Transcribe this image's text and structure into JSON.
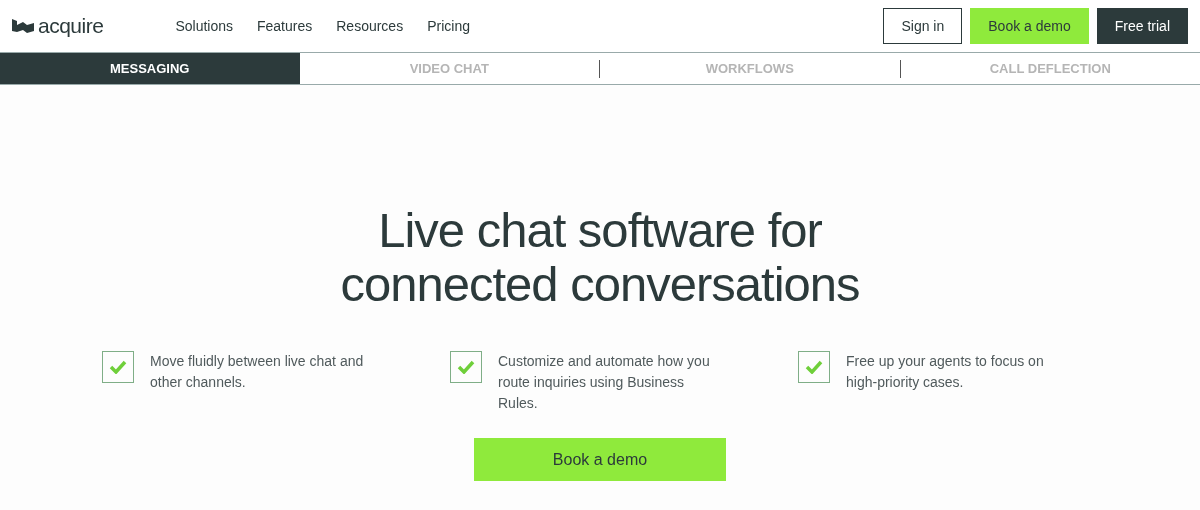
{
  "brand": {
    "name": "acquire"
  },
  "nav": {
    "links": [
      "Solutions",
      "Features",
      "Resources",
      "Pricing"
    ],
    "buttons": [
      {
        "label": "Sign in",
        "kind": "outline"
      },
      {
        "label": "Book a demo",
        "kind": "accent"
      },
      {
        "label": "Free trial",
        "kind": "dark"
      }
    ]
  },
  "tabs": [
    {
      "label": "MESSAGING",
      "selected": true
    },
    {
      "label": "VIDEO CHAT",
      "selected": false
    },
    {
      "label": "WORKFLOWS",
      "selected": false
    },
    {
      "label": "CALL DEFLECTION",
      "selected": false
    }
  ],
  "hero": {
    "title_lines": [
      "Live chat software for",
      "connected conversations"
    ],
    "features": [
      {
        "text": "Move fluidly between live chat and other channels.",
        "checked": true
      },
      {
        "text": "Customize and automate how you route inquiries using Business Rules.",
        "checked": true
      },
      {
        "text": "Free up your agents to focus on high-priority cases.",
        "checked": true
      }
    ],
    "cta": "Book a demo"
  }
}
